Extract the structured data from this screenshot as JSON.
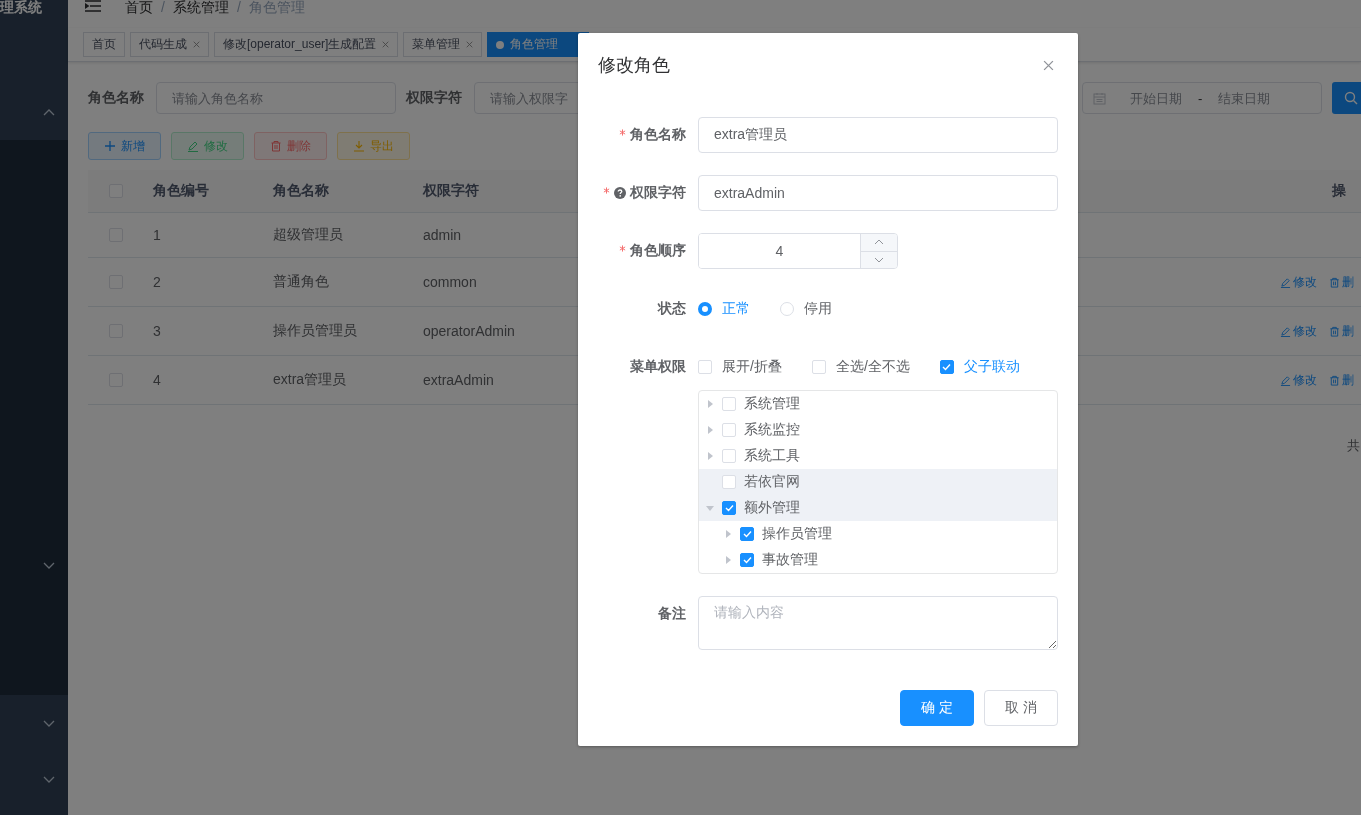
{
  "sidebar": {
    "title": "理系统",
    "menus": [
      {
        "expanded": true,
        "children": [
          {
            "expanded": false
          }
        ]
      },
      {
        "expanded": false
      },
      {
        "expanded": false
      }
    ]
  },
  "navbar": {
    "breadcrumb": [
      "首页",
      "系统管理",
      "角色管理"
    ],
    "separator": "/"
  },
  "tags": [
    {
      "label": "首页",
      "closable": false,
      "selected": false
    },
    {
      "label": "代码生成",
      "closable": true,
      "selected": false
    },
    {
      "label": "修改[operator_user]生成配置",
      "closable": true,
      "selected": false
    },
    {
      "label": "菜单管理",
      "closable": true,
      "selected": false
    },
    {
      "label": "角色管理",
      "closable": false,
      "selected": true
    }
  ],
  "search": {
    "fields": [
      {
        "label": "角色名称",
        "placeholder": "请输入角色名称"
      },
      {
        "label": "权限字符",
        "placeholder": "请输入权限字"
      }
    ],
    "date_range": {
      "start_placeholder": "开始日期",
      "separator": "-",
      "end_placeholder": "结束日期"
    }
  },
  "toolbar": [
    {
      "kind": "add",
      "label": "新增",
      "disabled": false
    },
    {
      "kind": "edit",
      "label": "修改",
      "disabled": true
    },
    {
      "kind": "delete",
      "label": "删除",
      "disabled": true
    },
    {
      "kind": "export",
      "label": "导出",
      "disabled": false
    }
  ],
  "table": {
    "all_checked": false,
    "columns": [
      "角色编号",
      "角色名称",
      "权限字符"
    ],
    "action_column": "操",
    "rows": [
      {
        "checked": false,
        "cells": [
          "1",
          "超级管理员",
          "admin"
        ]
      },
      {
        "checked": false,
        "cells": [
          "2",
          "普通角色",
          "common"
        ],
        "actions": [
          {
            "kind": "edit",
            "label": "修改"
          },
          {
            "kind": "delete",
            "label": "删"
          }
        ]
      },
      {
        "checked": false,
        "cells": [
          "3",
          "操作员管理员",
          "operatorAdmin"
        ],
        "actions": [
          {
            "kind": "edit",
            "label": "修改"
          },
          {
            "kind": "delete",
            "label": "删"
          }
        ]
      },
      {
        "checked": false,
        "cells": [
          "4",
          "extra管理员",
          "extraAdmin"
        ],
        "actions": [
          {
            "kind": "edit",
            "label": "修改"
          },
          {
            "kind": "delete",
            "label": "删"
          }
        ]
      }
    ]
  },
  "pagination": {
    "total_text": "共"
  },
  "dialog": {
    "title": "修改角色",
    "fields": [
      {
        "kind": "text",
        "label": "角色名称",
        "required": true,
        "help": false,
        "value": "extra管理员"
      },
      {
        "kind": "text",
        "label": "权限字符",
        "required": true,
        "help": true,
        "value": "extraAdmin"
      },
      {
        "kind": "number",
        "label": "角色顺序",
        "required": true,
        "help": false,
        "value": "4"
      },
      {
        "kind": "radio",
        "label": "状态",
        "required": false,
        "help": false,
        "options": [
          {
            "label": "正常",
            "selected": true
          },
          {
            "label": "停用",
            "selected": false
          }
        ]
      },
      {
        "kind": "menu_tree",
        "label": "菜单权限",
        "required": false,
        "help": false,
        "options": [
          {
            "label": "展开/折叠",
            "checked": false
          },
          {
            "label": "全选/全不选",
            "checked": false
          },
          {
            "label": "父子联动",
            "checked": true
          }
        ],
        "tree": [
          {
            "label": "系统管理",
            "checked": false,
            "expanded": false,
            "highlighted": false
          },
          {
            "label": "系统监控",
            "checked": false,
            "expanded": false,
            "highlighted": false
          },
          {
            "label": "系统工具",
            "checked": false,
            "expanded": false,
            "highlighted": false
          },
          {
            "label": "若依官网",
            "checked": false,
            "highlighted": true
          },
          {
            "label": "额外管理",
            "checked": true,
            "expanded": true,
            "highlighted": true,
            "children": [
              {
                "label": "操作员管理",
                "checked": true,
                "expanded": false,
                "highlighted": false
              },
              {
                "label": "事故管理",
                "checked": true,
                "expanded": false,
                "highlighted": false
              }
            ]
          }
        ]
      },
      {
        "kind": "textarea",
        "label": "备注",
        "required": false,
        "help": false,
        "placeholder": "请输入内容"
      }
    ],
    "buttons": [
      {
        "label": "确 定",
        "primary": true
      },
      {
        "label": "取 消",
        "primary": false
      }
    ]
  }
}
